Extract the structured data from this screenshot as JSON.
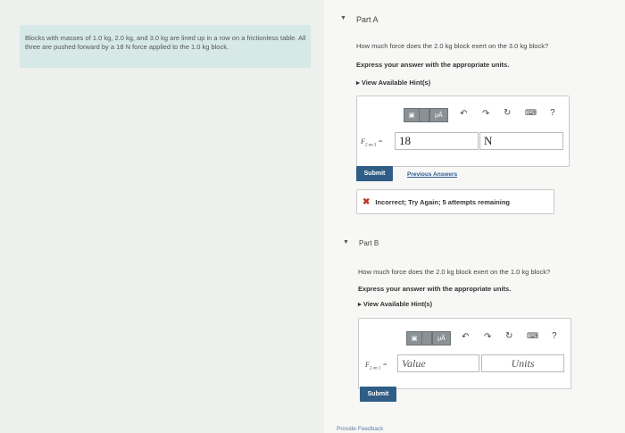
{
  "problem": {
    "text": "Blocks with masses of 1.0 kg, 2.0 kg, and 3.0 kg are lined up in a row on a frictionless table. All three are pushed forward by a 18 N force applied to the 1.0 kg block."
  },
  "partA": {
    "title": "Part A",
    "question": "How much force does the 2.0 kg block exert on the 3.0 kg block?",
    "instruction": "Express your answer with the appropriate units.",
    "hints": "View Available Hint(s)",
    "toolbar": {
      "templates": "▣",
      "mu": "μÅ",
      "help": "?"
    },
    "label": "F",
    "label_sub": "2 on 3",
    "value": "18",
    "units": "N",
    "submit": "Submit",
    "previous": "Previous Answers",
    "feedback": "Incorrect; Try Again; 5 attempts remaining"
  },
  "partB": {
    "title": "Part B",
    "question": "How much force does the 2.0 kg block exert on the 1.0 kg block?",
    "instruction": "Express your answer with the appropriate units.",
    "hints": "View Available Hint(s)",
    "toolbar": {
      "templates": "▣",
      "mu": "μÅ",
      "help": "?"
    },
    "label": "F",
    "label_sub": "2 on 1",
    "value_placeholder": "Value",
    "units_placeholder": "Units",
    "submit": "Submit"
  },
  "footer": {
    "feedback_link": "Provide Feedback"
  }
}
